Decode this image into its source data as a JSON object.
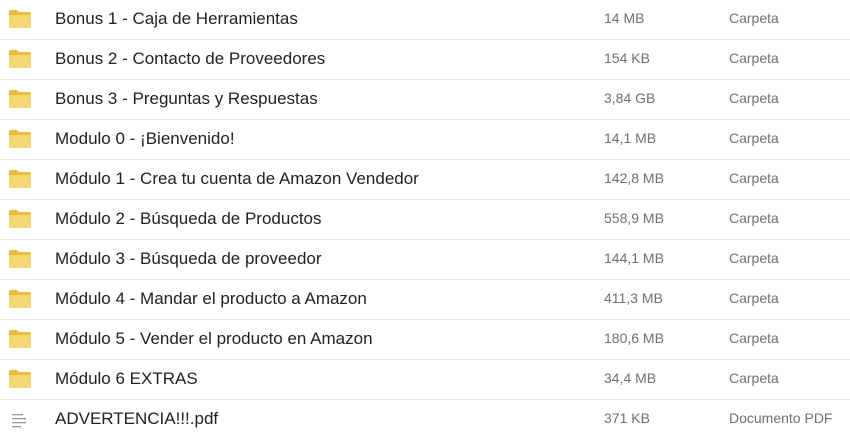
{
  "colors": {
    "folder_fill": "#F7D775",
    "folder_tab": "#E8BD3F",
    "text_primary": "#222222",
    "text_secondary": "#707070",
    "divider": "#E9E9E9"
  },
  "files": [
    {
      "name": "Bonus 1 - Caja de Herramientas",
      "size": "14 MB",
      "type": "Carpeta",
      "icon": "folder-icon"
    },
    {
      "name": "Bonus 2 - Contacto de Proveedores",
      "size": "154 KB",
      "type": "Carpeta",
      "icon": "folder-icon"
    },
    {
      "name": "Bonus 3 - Preguntas y Respuestas",
      "size": "3,84 GB",
      "type": "Carpeta",
      "icon": "folder-icon"
    },
    {
      "name": "Modulo 0 - ¡Bienvenido!",
      "size": "14,1 MB",
      "type": "Carpeta",
      "icon": "folder-icon"
    },
    {
      "name": "Módulo 1 - Crea tu cuenta de Amazon Vendedor",
      "size": "142,8 MB",
      "type": "Carpeta",
      "icon": "folder-icon"
    },
    {
      "name": "Módulo 2 - Búsqueda de Productos",
      "size": "558,9 MB",
      "type": "Carpeta",
      "icon": "folder-icon"
    },
    {
      "name": "Módulo 3 - Búsqueda de proveedor",
      "size": "144,1 MB",
      "type": "Carpeta",
      "icon": "folder-icon"
    },
    {
      "name": "Módulo 4 - Mandar el producto a Amazon",
      "size": "411,3 MB",
      "type": "Carpeta",
      "icon": "folder-icon"
    },
    {
      "name": "Módulo 5 - Vender el producto en Amazon",
      "size": "180,6 MB",
      "type": "Carpeta",
      "icon": "folder-icon"
    },
    {
      "name": "Módulo 6 EXTRAS",
      "size": "34,4 MB",
      "type": "Carpeta",
      "icon": "folder-icon"
    },
    {
      "name": "ADVERTENCIA!!!.pdf",
      "size": "371 KB",
      "type": "Documento PDF",
      "icon": "document-icon"
    }
  ]
}
